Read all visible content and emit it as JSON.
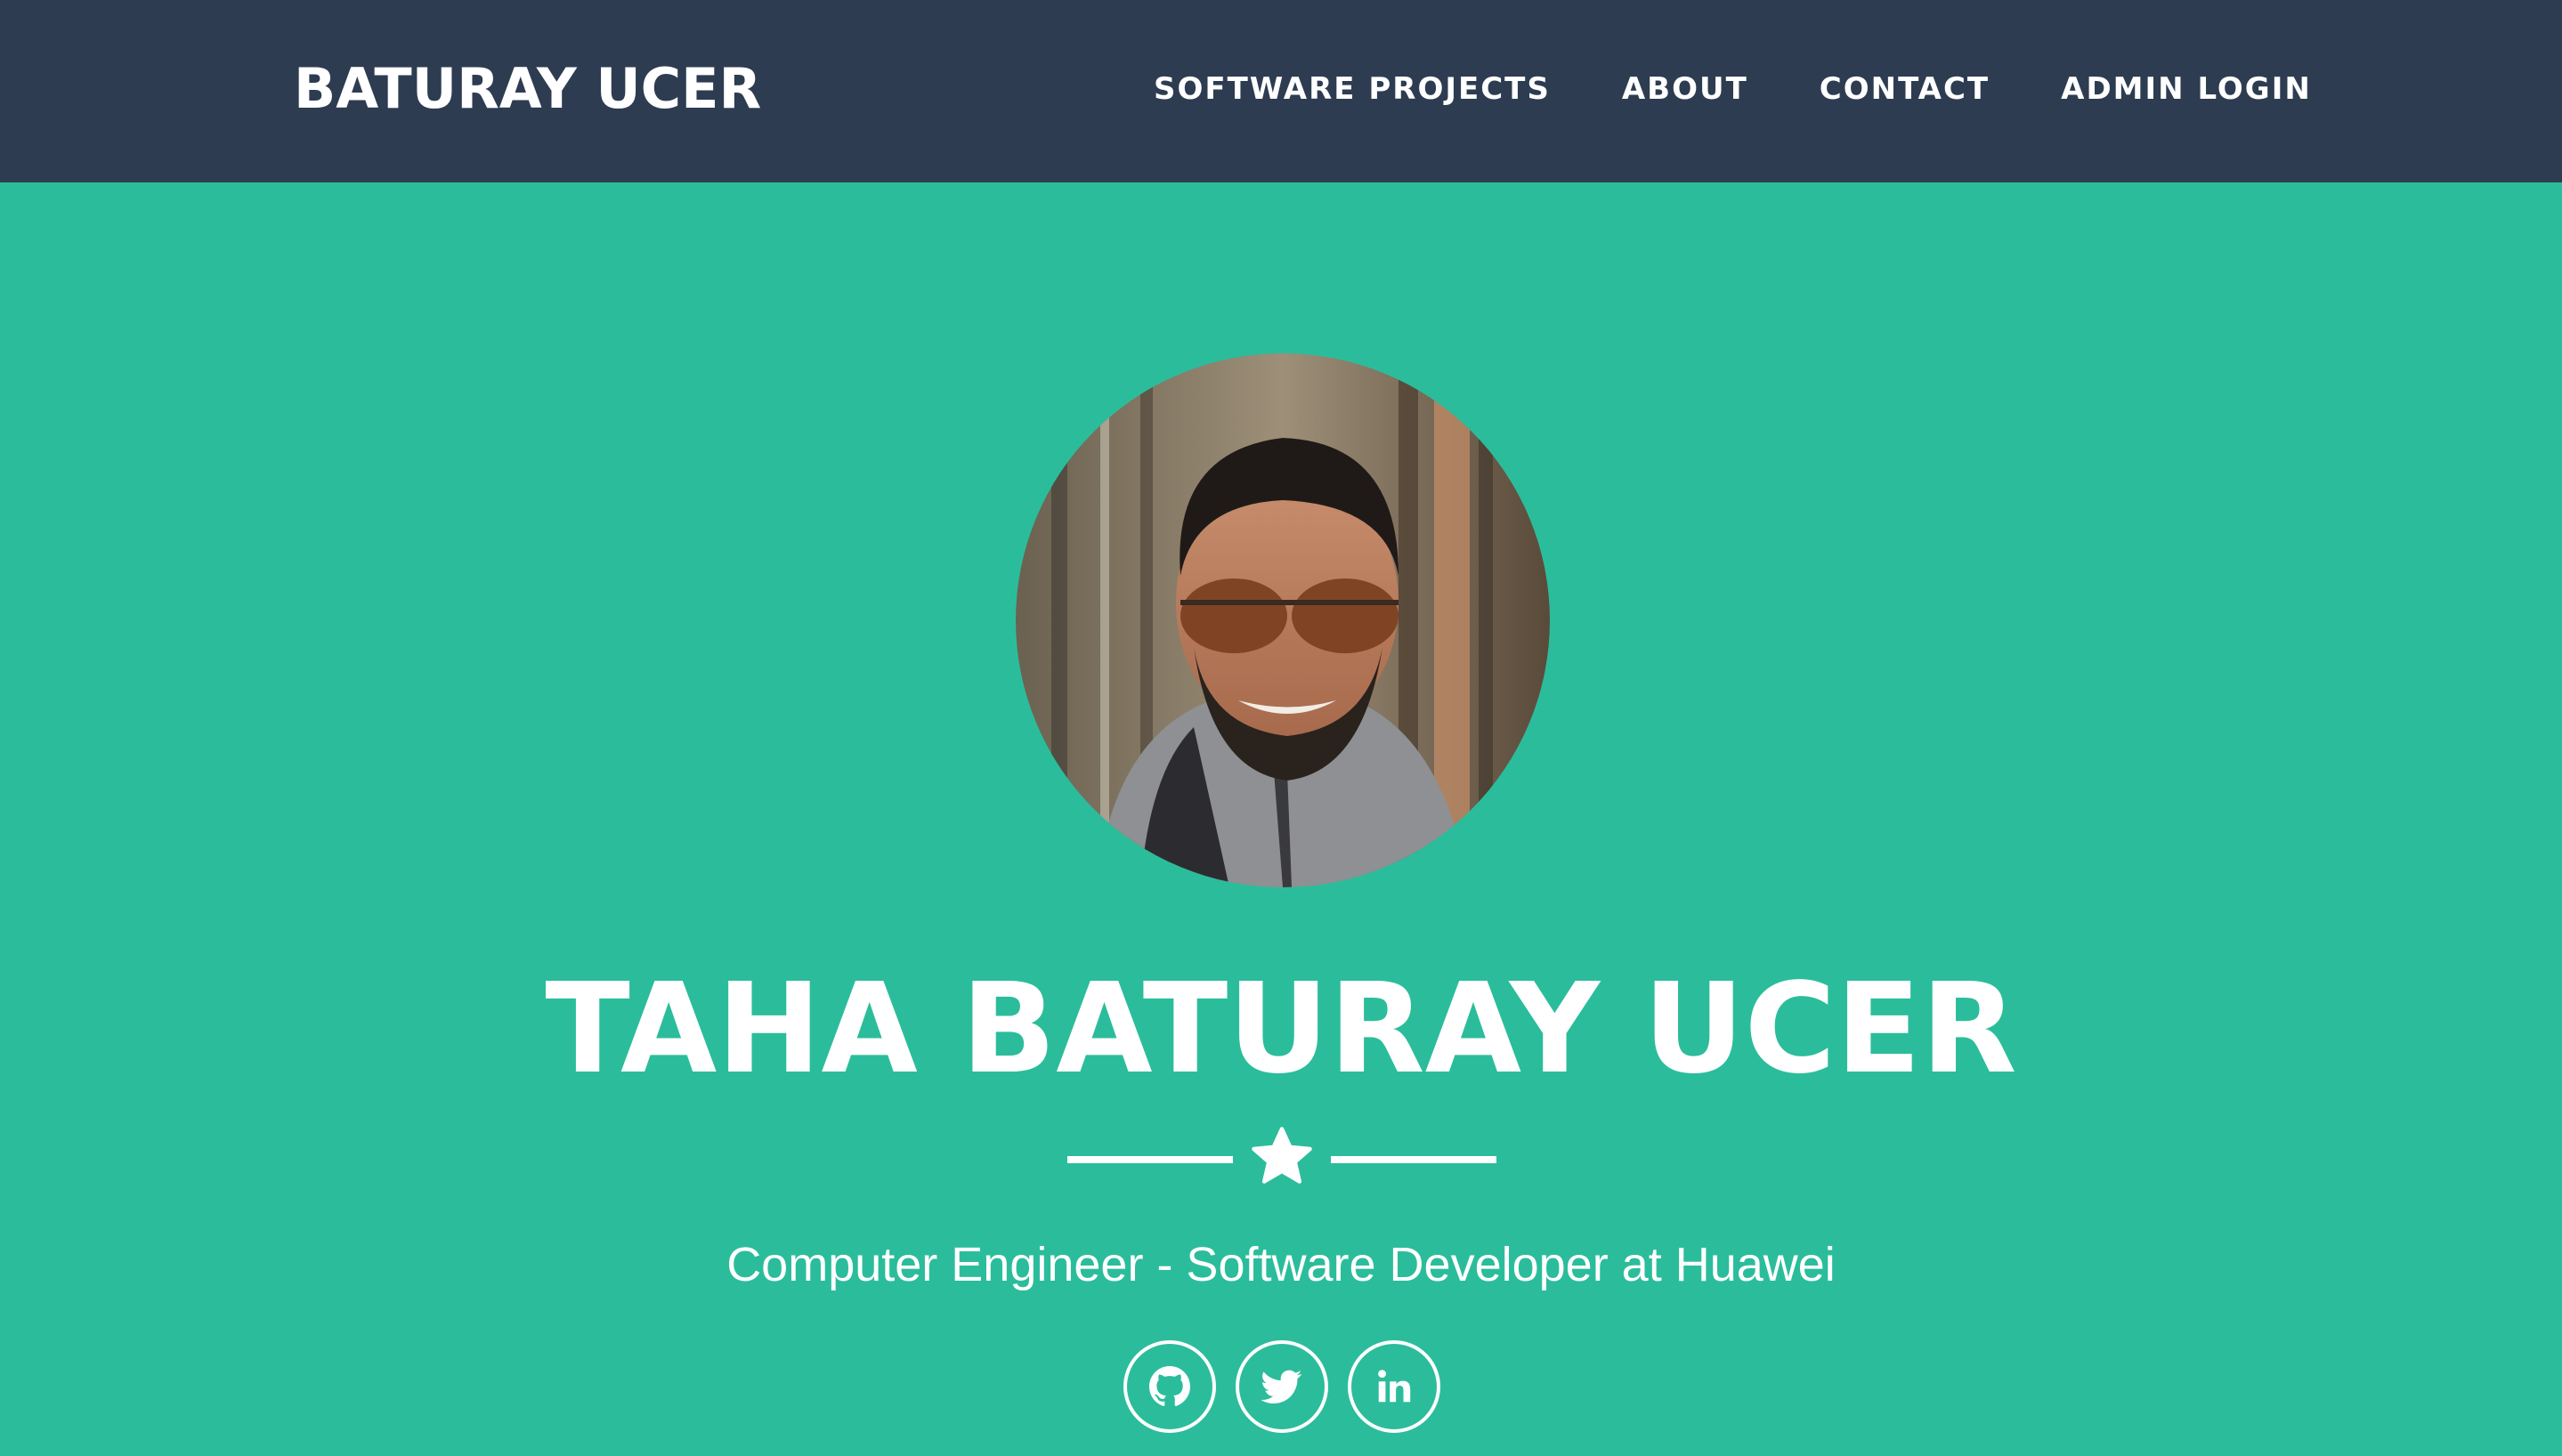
{
  "navbar": {
    "brand": "BATURAY UCER",
    "links": [
      {
        "label": "SOFTWARE PROJECTS"
      },
      {
        "label": "ABOUT"
      },
      {
        "label": "CONTACT"
      },
      {
        "label": "ADMIN LOGIN"
      }
    ]
  },
  "hero": {
    "name": "TAHA BATURAY UCER",
    "subtitle": "Computer Engineer - Software Developer at Huawei",
    "divider_icon": "star-icon",
    "socials": [
      {
        "icon": "github-icon"
      },
      {
        "icon": "twitter-icon"
      },
      {
        "icon": "linkedin-icon"
      }
    ]
  },
  "colors": {
    "navbar_bg": "#2d3c51",
    "hero_bg": "#2bbd9b",
    "text": "#ffffff"
  }
}
